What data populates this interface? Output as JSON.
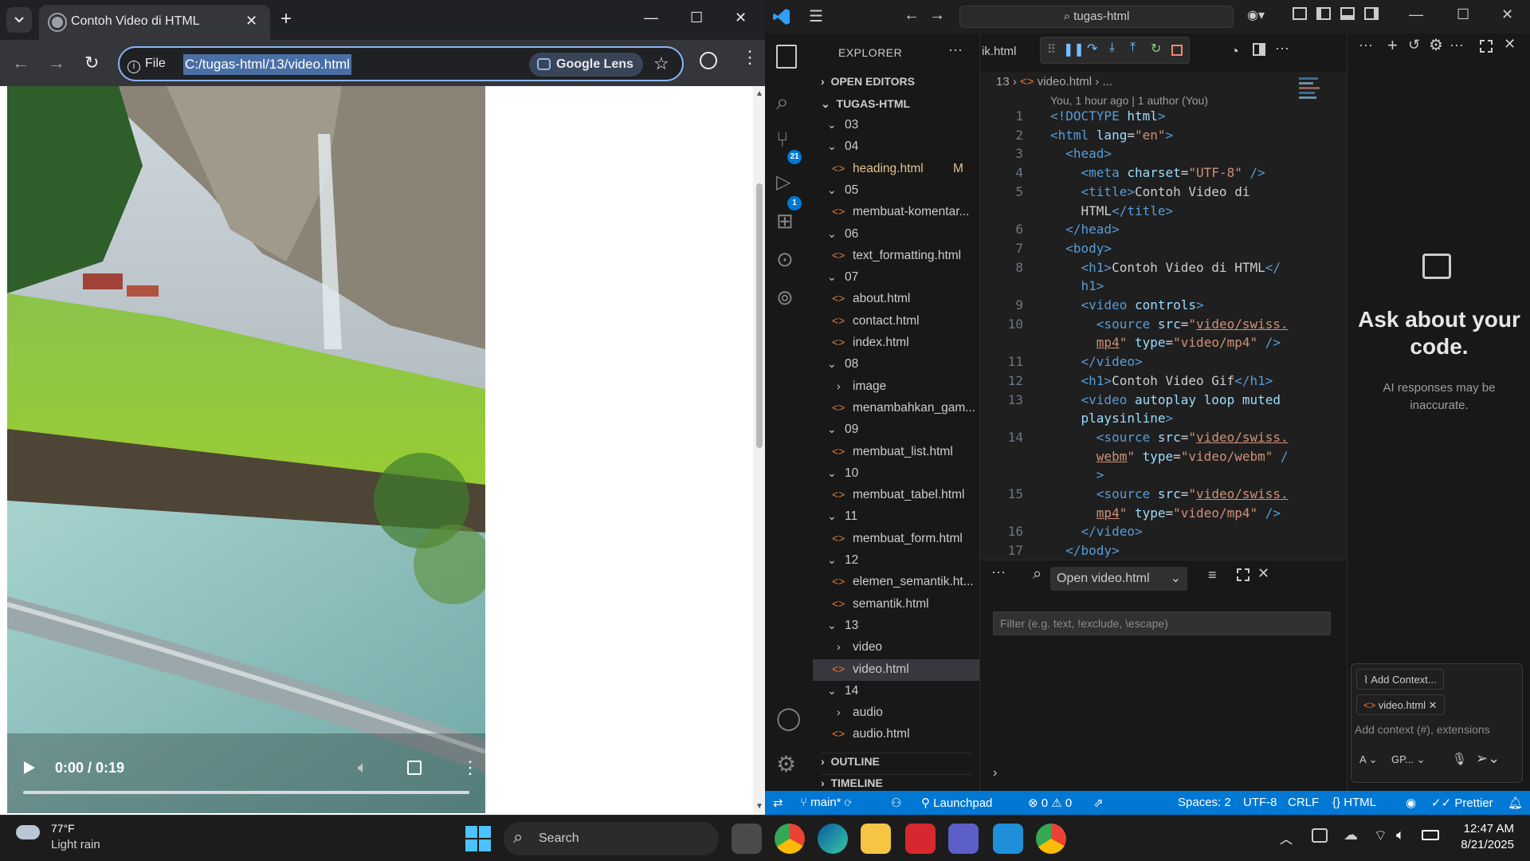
{
  "chrome": {
    "tab_title": "Contoh Video di HTML",
    "scheme_label": "File",
    "url": "C:/tugas-html/13/video.html",
    "lens_label": "Google Lens",
    "video_time": "0:00 / 0:19",
    "video_progress": 0.0
  },
  "vscode": {
    "search_text": "tugas-html",
    "explorer_title": "EXPLORER",
    "sections": {
      "open_editors": "OPEN EDITORS",
      "root": "TUGAS-HTML",
      "outline": "OUTLINE",
      "timeline": "TIMELINE"
    },
    "tree": [
      {
        "label": "03",
        "type": "folder"
      },
      {
        "label": "04",
        "type": "folder"
      },
      {
        "label": "heading.html",
        "type": "file",
        "badge": "M"
      },
      {
        "label": "05",
        "type": "folder"
      },
      {
        "label": "membuat-komentar...",
        "type": "file"
      },
      {
        "label": "06",
        "type": "folder"
      },
      {
        "label": "text_formatting.html",
        "type": "file"
      },
      {
        "label": "07",
        "type": "folder"
      },
      {
        "label": "about.html",
        "type": "file"
      },
      {
        "label": "contact.html",
        "type": "file"
      },
      {
        "label": "index.html",
        "type": "file"
      },
      {
        "label": "08",
        "type": "folder"
      },
      {
        "label": "image",
        "type": "subfolder"
      },
      {
        "label": "menambahkan_gam...",
        "type": "file"
      },
      {
        "label": "09",
        "type": "folder"
      },
      {
        "label": "membuat_list.html",
        "type": "file"
      },
      {
        "label": "10",
        "type": "folder"
      },
      {
        "label": "membuat_tabel.html",
        "type": "file"
      },
      {
        "label": "11",
        "type": "folder"
      },
      {
        "label": "membuat_form.html",
        "type": "file"
      },
      {
        "label": "12",
        "type": "folder"
      },
      {
        "label": "elemen_semantik.ht...",
        "type": "file"
      },
      {
        "label": "semantik.html",
        "type": "file"
      },
      {
        "label": "13",
        "type": "folder"
      },
      {
        "label": "video",
        "type": "subfolder"
      },
      {
        "label": "video.html",
        "type": "file",
        "selected": true
      },
      {
        "label": "14",
        "type": "folder"
      },
      {
        "label": "audio",
        "type": "subfolder"
      },
      {
        "label": "audio.html",
        "type": "file"
      }
    ],
    "badges": {
      "source_control": "21",
      "debug": "1"
    },
    "editor": {
      "tab_partial": "ik.html",
      "breadcrumb_folder": "13",
      "breadcrumb_file": "video.html",
      "breadcrumb_more": "...",
      "blame": "You, 1 hour ago | 1 author (You)",
      "lines": [
        {
          "n": "1",
          "seg": [
            [
              "t",
              "<!DOCTYPE "
            ],
            [
              "a",
              "html"
            ],
            [
              "t",
              ">"
            ]
          ]
        },
        {
          "n": "2",
          "seg": [
            [
              "t",
              "<html "
            ],
            [
              "a",
              "lang"
            ],
            [
              "x",
              "="
            ],
            [
              "s",
              "\"en\""
            ],
            [
              "t",
              ">"
            ]
          ]
        },
        {
          "n": "3",
          "seg": [
            [
              "x",
              "  "
            ],
            [
              "t",
              "<head>"
            ]
          ]
        },
        {
          "n": "4",
          "seg": [
            [
              "x",
              "    "
            ],
            [
              "t",
              "<meta "
            ],
            [
              "a",
              "charset"
            ],
            [
              "x",
              "="
            ],
            [
              "s",
              "\"UTF-8\""
            ],
            [
              "t",
              " />"
            ]
          ]
        },
        {
          "n": "5",
          "seg": [
            [
              "x",
              "    "
            ],
            [
              "t",
              "<title>"
            ],
            [
              "x",
              "Contoh Video di"
            ]
          ]
        },
        {
          "n": "",
          "seg": [
            [
              "x",
              "    HTML"
            ],
            [
              "t",
              "</title>"
            ]
          ]
        },
        {
          "n": "6",
          "seg": [
            [
              "x",
              "  "
            ],
            [
              "t",
              "</head>"
            ]
          ]
        },
        {
          "n": "7",
          "seg": [
            [
              "x",
              "  "
            ],
            [
              "t",
              "<body>"
            ]
          ]
        },
        {
          "n": "8",
          "seg": [
            [
              "x",
              "    "
            ],
            [
              "t",
              "<h1>"
            ],
            [
              "x",
              "Contoh Video di HTML"
            ],
            [
              "t",
              "</"
            ]
          ]
        },
        {
          "n": "",
          "seg": [
            [
              "t",
              "    h1>"
            ]
          ]
        },
        {
          "n": "9",
          "seg": [
            [
              "x",
              "    "
            ],
            [
              "t",
              "<video "
            ],
            [
              "a",
              "controls"
            ],
            [
              "t",
              ">"
            ]
          ]
        },
        {
          "n": "10",
          "seg": [
            [
              "x",
              "      "
            ],
            [
              "t",
              "<source "
            ],
            [
              "a",
              "src"
            ],
            [
              "x",
              "="
            ],
            [
              "s",
              "\""
            ],
            [
              "su",
              "video/swiss."
            ]
          ]
        },
        {
          "n": "",
          "seg": [
            [
              "x",
              "      "
            ],
            [
              "su",
              "mp4"
            ],
            [
              "s",
              "\""
            ],
            [
              "a",
              " type"
            ],
            [
              "x",
              "="
            ],
            [
              "s",
              "\"video/mp4\""
            ],
            [
              "t",
              " />"
            ]
          ]
        },
        {
          "n": "11",
          "seg": [
            [
              "x",
              "    "
            ],
            [
              "t",
              "</video>"
            ]
          ]
        },
        {
          "n": "12",
          "seg": [
            [
              "x",
              "    "
            ],
            [
              "t",
              "<h1>"
            ],
            [
              "x",
              "Contoh Video Gif"
            ],
            [
              "t",
              "</h1>"
            ]
          ]
        },
        {
          "n": "13",
          "seg": [
            [
              "x",
              "    "
            ],
            [
              "t",
              "<video "
            ],
            [
              "a",
              "autoplay loop muted"
            ]
          ]
        },
        {
          "n": "",
          "seg": [
            [
              "a",
              "    playsinline"
            ],
            [
              "t",
              ">"
            ]
          ]
        },
        {
          "n": "14",
          "seg": [
            [
              "x",
              "      "
            ],
            [
              "t",
              "<source "
            ],
            [
              "a",
              "src"
            ],
            [
              "x",
              "="
            ],
            [
              "s",
              "\""
            ],
            [
              "su",
              "video/swiss."
            ]
          ]
        },
        {
          "n": "",
          "seg": [
            [
              "x",
              "      "
            ],
            [
              "su",
              "webm"
            ],
            [
              "s",
              "\""
            ],
            [
              "a",
              " type"
            ],
            [
              "x",
              "="
            ],
            [
              "s",
              "\"video/webm\""
            ],
            [
              "t",
              " /"
            ]
          ]
        },
        {
          "n": "",
          "seg": [
            [
              "t",
              "      >"
            ]
          ]
        },
        {
          "n": "15",
          "seg": [
            [
              "x",
              "      "
            ],
            [
              "t",
              "<source "
            ],
            [
              "a",
              "src"
            ],
            [
              "x",
              "="
            ],
            [
              "s",
              "\""
            ],
            [
              "su",
              "video/swiss."
            ]
          ]
        },
        {
          "n": "",
          "seg": [
            [
              "x",
              "      "
            ],
            [
              "su",
              "mp4"
            ],
            [
              "s",
              "\""
            ],
            [
              "a",
              " type"
            ],
            [
              "x",
              "="
            ],
            [
              "s",
              "\"video/mp4\""
            ],
            [
              "t",
              " />"
            ]
          ]
        },
        {
          "n": "16",
          "seg": [
            [
              "x",
              "    "
            ],
            [
              "t",
              "</video>"
            ]
          ]
        },
        {
          "n": "17",
          "seg": [
            [
              "x",
              "  "
            ],
            [
              "t",
              "</body>"
            ]
          ]
        }
      ]
    },
    "panel": {
      "dropdown": "Open video.html",
      "filter_placeholder": "Filter (e.g. text, !exclude, \\escape)"
    },
    "chat": {
      "heading": "Ask about your code.",
      "disclaimer": "AI responses may be inaccurate.",
      "add_context": "Add Context...",
      "context_file": "video.html",
      "input_placeholder": "Add context (#), extensions",
      "mode": "A",
      "model": "GP..."
    },
    "status": {
      "branch": "main*",
      "launchpad": "Launchpad",
      "errors": "0",
      "warnings": "0",
      "spaces": "Spaces: 2",
      "encoding": "UTF-8",
      "eol": "CRLF",
      "language": "HTML",
      "prettier": "Prettier"
    }
  },
  "taskbar": {
    "weather_temp": "77°F",
    "weather_desc": "Light rain",
    "search_label": "Search",
    "time": "12:47 AM",
    "date": "8/21/2025"
  },
  "colors": {
    "vscode_blue": "#0078d4",
    "chrome_focus": "#8ab4f8",
    "editor_bg": "#1f1f1f"
  }
}
